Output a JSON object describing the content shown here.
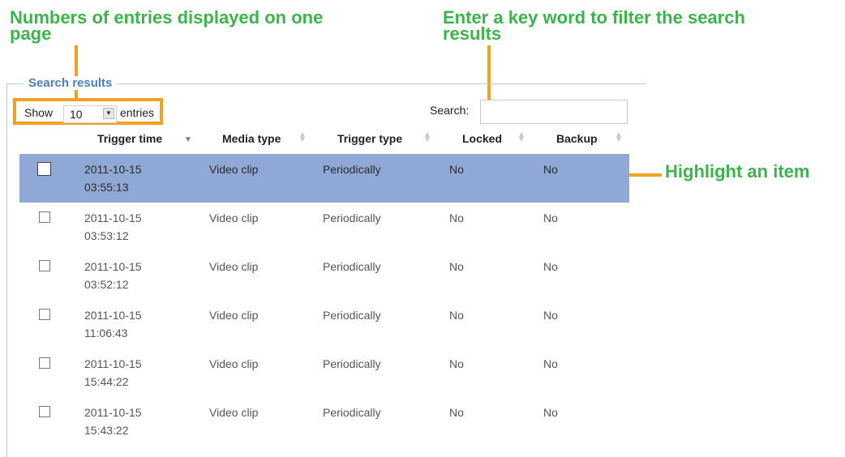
{
  "annotations": {
    "entries": "Numbers of entries displayed on one page",
    "search": "Enter a key word to filter the search results",
    "highlight": "Highlight an item"
  },
  "panel": {
    "legend": "Search results",
    "show_label": "Show",
    "entries_value": "10",
    "entries_label": "entries",
    "search_label": "Search:",
    "search_value": ""
  },
  "table": {
    "columns": [
      "Trigger time",
      "Media type",
      "Trigger type",
      "Locked",
      "Backup"
    ],
    "rows": [
      {
        "date": "2011-10-15",
        "time": "03:55:13",
        "media": "Video clip",
        "trigger": "Periodically",
        "locked": "No",
        "backup": "No",
        "selected": true
      },
      {
        "date": "2011-10-15",
        "time": "03:53:12",
        "media": "Video clip",
        "trigger": "Periodically",
        "locked": "No",
        "backup": "No",
        "selected": false
      },
      {
        "date": "2011-10-15",
        "time": "03:52:12",
        "media": "Video clip",
        "trigger": "Periodically",
        "locked": "No",
        "backup": "No",
        "selected": false
      },
      {
        "date": "2011-10-15",
        "time": "11:06:43",
        "media": "Video clip",
        "trigger": "Periodically",
        "locked": "No",
        "backup": "No",
        "selected": false
      },
      {
        "date": "2011-10-15",
        "time": "15:44:22",
        "media": "Video clip",
        "trigger": "Periodically",
        "locked": "No",
        "backup": "No",
        "selected": false
      },
      {
        "date": "2011-10-15",
        "time": "15:43:22",
        "media": "Video clip",
        "trigger": "Periodically",
        "locked": "No",
        "backup": "No",
        "selected": false
      }
    ]
  },
  "colors": {
    "annotation_text": "#3bb54a",
    "annotation_line": "#f0a323",
    "selected_row": "#8fa8d6",
    "legend_text": "#4a7fc0"
  }
}
